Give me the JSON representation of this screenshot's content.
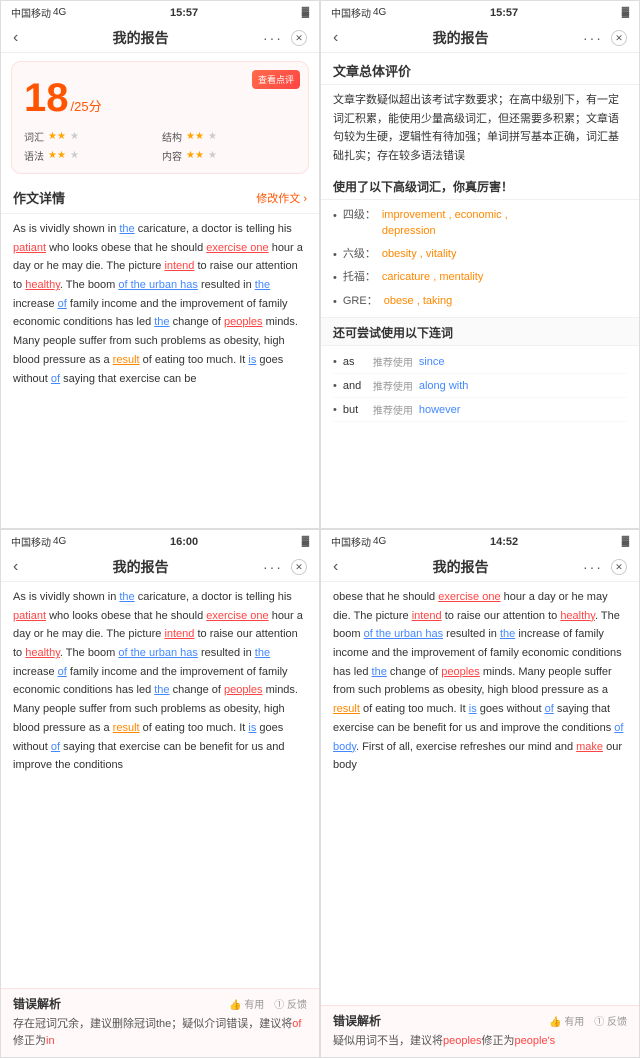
{
  "panel1": {
    "status": {
      "carrier": "中国移动",
      "network": "4G",
      "time": "15:57",
      "battery": "🔋"
    },
    "nav": {
      "title": "我的报告",
      "back": "‹",
      "dots": "···",
      "close": "✕"
    },
    "score_card": {
      "check_btn": "查看点评",
      "score": "18",
      "denom": "/25分",
      "items": [
        {
          "label": "词汇",
          "stars": 2,
          "max": 3
        },
        {
          "label": "结构",
          "stars": 2,
          "max": 3
        },
        {
          "label": "语法",
          "stars": 2,
          "max": 3
        },
        {
          "label": "内容",
          "stars": 2,
          "max": 3
        }
      ]
    },
    "essay_section": {
      "title": "作文详情",
      "link": "修改作文 ›",
      "text_parts": [
        {
          "t": "As is vividly shown in ",
          "style": ""
        },
        {
          "t": "the",
          "style": "underline-blue"
        },
        {
          "t": " caricature, a doctor is telling his ",
          "style": ""
        },
        {
          "t": "patiant",
          "style": "underline-red"
        },
        {
          "t": " who looks obese that he should ",
          "style": ""
        },
        {
          "t": "exercise one",
          "style": "underline-red"
        },
        {
          "t": " hour a day or he may die. The picture ",
          "style": ""
        },
        {
          "t": "intend",
          "style": "underline-red"
        },
        {
          "t": " to raise our attention to ",
          "style": ""
        },
        {
          "t": "healthy",
          "style": "underline-red"
        },
        {
          "t": ". The boom ",
          "style": ""
        },
        {
          "t": "of the urban has",
          "style": "underline-blue"
        },
        {
          "t": " resulted in ",
          "style": ""
        },
        {
          "t": "the",
          "style": "underline-blue"
        },
        {
          "t": " increase ",
          "style": ""
        },
        {
          "t": "of",
          "style": "underline-blue"
        },
        {
          "t": " family income and the improvement of family economic conditions has led ",
          "style": ""
        },
        {
          "t": "the",
          "style": "underline-blue"
        },
        {
          "t": " change of ",
          "style": ""
        },
        {
          "t": "peoples",
          "style": "underline-red"
        },
        {
          "t": " minds. Many people suffer from such problems as obesity, high blood pressure as a ",
          "style": ""
        },
        {
          "t": "result",
          "style": "underline-orange"
        },
        {
          "t": " of eating too much. It ",
          "style": ""
        },
        {
          "t": "is",
          "style": "underline-blue"
        },
        {
          "t": " goes without ",
          "style": ""
        },
        {
          "t": "of",
          "style": "underline-blue"
        },
        {
          "t": " saying that exercise can be",
          "style": ""
        }
      ]
    }
  },
  "panel2": {
    "status": {
      "carrier": "中国移动",
      "network": "4G",
      "time": "15:57",
      "battery": "🔋"
    },
    "nav": {
      "title": "我的报告",
      "back": "‹",
      "dots": "···",
      "close": "✕"
    },
    "overall": {
      "title": "文章总体评价",
      "text": "文章字数疑似超出该考试字数要求；在高中级别下，有一定词汇积累，能使用少量高级词汇，但还需要多积累；文章语句较为生硬，逻辑性有待加强；单词拼写基本正确，词汇基础扎实；存在较多语法错误"
    },
    "vocab": {
      "title": "使用了以下高级词汇，你真厉害！",
      "items": [
        {
          "level": "四级：",
          "words": "improvement , economic , depression"
        },
        {
          "level": "六级：",
          "words": "obesity , vitality"
        },
        {
          "level": "托福：",
          "words": "caricature , mentality"
        },
        {
          "level": "GRE：",
          "words": "obese , taking"
        }
      ]
    },
    "connectors": {
      "title": "还可尝试使用以下连词",
      "items": [
        {
          "word": "as",
          "recommend": "推荐使用",
          "alt": "since"
        },
        {
          "word": "and",
          "recommend": "推荐使用",
          "alt": "along with"
        },
        {
          "word": "but",
          "recommend": "推荐使用",
          "alt": "however"
        }
      ]
    }
  },
  "panel3": {
    "status": {
      "carrier": "中国移动",
      "network": "4G",
      "time": "16:00",
      "battery": "🔋"
    },
    "nav": {
      "title": "我的报告",
      "back": "‹",
      "dots": "···",
      "close": "✕"
    },
    "essay_text_parts": [
      {
        "t": "As is vividly shown in ",
        "style": ""
      },
      {
        "t": "the",
        "style": "underline-blue"
      },
      {
        "t": " caricature, a doctor is telling his ",
        "style": ""
      },
      {
        "t": "patiant",
        "style": "underline-red"
      },
      {
        "t": " who looks obese that he should ",
        "style": ""
      },
      {
        "t": "exercise one",
        "style": "underline-red"
      },
      {
        "t": " hour a day or he may die. The picture ",
        "style": ""
      },
      {
        "t": "intend",
        "style": "underline-red"
      },
      {
        "t": " to raise our attention to ",
        "style": ""
      },
      {
        "t": "healthy",
        "style": "underline-red"
      },
      {
        "t": ". The boom ",
        "style": ""
      },
      {
        "t": "of the urban has",
        "style": "underline-blue"
      },
      {
        "t": " resulted in ",
        "style": ""
      },
      {
        "t": "the",
        "style": "underline-blue"
      },
      {
        "t": " increase ",
        "style": ""
      },
      {
        "t": "of",
        "style": "underline-blue"
      },
      {
        "t": " family income and the improvement of family economic conditions has led ",
        "style": ""
      },
      {
        "t": "the",
        "style": "underline-blue"
      },
      {
        "t": " change of ",
        "style": ""
      },
      {
        "t": "peoples",
        "style": "underline-red"
      },
      {
        "t": " minds. Many people suffer from such problems as obesity, high blood pressure as a ",
        "style": ""
      },
      {
        "t": "result",
        "style": "underline-orange"
      },
      {
        "t": " of eating too much. It ",
        "style": ""
      },
      {
        "t": "is",
        "style": "underline-blue"
      },
      {
        "t": " goes without ",
        "style": ""
      },
      {
        "t": "of",
        "style": "underline-blue"
      },
      {
        "t": " saying that exercise can be benefit for us and improve the conditions",
        "style": ""
      }
    ],
    "error": {
      "title": "错误解析",
      "useful": "👍 有用",
      "feedback": "① 反馈",
      "text": "存在冠词冗余，建议删除冠词the；疑似介词错误，建议将",
      "highlight": "of",
      "text2": "修正为",
      "highlight2": "in"
    }
  },
  "panel4": {
    "status": {
      "carrier": "中国移动",
      "network": "4G",
      "time": "14:52",
      "battery": "🔋"
    },
    "nav": {
      "title": "我的报告",
      "back": "‹",
      "dots": "···",
      "close": "✕"
    },
    "essay_text_parts": [
      {
        "t": "obese that he should ",
        "style": ""
      },
      {
        "t": "exercise one",
        "style": "underline-red"
      },
      {
        "t": " hour a day or he may die. The picture ",
        "style": ""
      },
      {
        "t": "intend",
        "style": "underline-red"
      },
      {
        "t": " to raise our attention to ",
        "style": ""
      },
      {
        "t": "healthy",
        "style": "underline-red"
      },
      {
        "t": ". The boom ",
        "style": ""
      },
      {
        "t": "of the urban has",
        "style": "underline-blue"
      },
      {
        "t": " resulted in ",
        "style": ""
      },
      {
        "t": "the",
        "style": "underline-blue"
      },
      {
        "t": " increase of family income and the improvement of family economic conditions has led ",
        "style": ""
      },
      {
        "t": "the",
        "style": "underline-blue"
      },
      {
        "t": " change of ",
        "style": ""
      },
      {
        "t": "peoples",
        "style": "underline-red"
      },
      {
        "t": " minds. Many people suffer from such problems as obesity, high blood pressure as a ",
        "style": ""
      },
      {
        "t": "result",
        "style": "underline-orange"
      },
      {
        "t": " of eating too much. It ",
        "style": ""
      },
      {
        "t": "is",
        "style": "underline-blue"
      },
      {
        "t": " goes without ",
        "style": ""
      },
      {
        "t": "of",
        "style": "underline-blue"
      },
      {
        "t": " saying that exercise can be benefit for us and improve the conditions ",
        "style": ""
      },
      {
        "t": "of body",
        "style": "underline-blue"
      },
      {
        "t": ". First of all, exercise refreshes our mind and ",
        "style": ""
      },
      {
        "t": "make",
        "style": "underline-red"
      },
      {
        "t": " our body",
        "style": ""
      }
    ],
    "error": {
      "title": "错误解析",
      "useful": "👍 有用",
      "feedback": "① 反馈",
      "text": "疑似用词不当，建议将",
      "highlight": "peoples",
      "text2": "修正为",
      "highlight2": "people's"
    }
  }
}
